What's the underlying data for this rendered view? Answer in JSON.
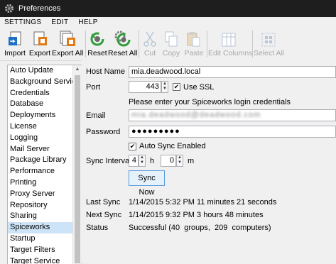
{
  "window": {
    "title": "Preferences"
  },
  "menu": [
    "SETTINGS",
    "EDIT",
    "HELP"
  ],
  "toolbar": {
    "import": "Import",
    "export": "Export",
    "export_all": "Export All",
    "reset": "Reset",
    "reset_all": "Reset All",
    "cut": "Cut",
    "copy": "Copy",
    "paste": "Paste",
    "edit_columns": "Edit Columns",
    "select_all": "Select All"
  },
  "nav": {
    "items": [
      "Auto Update",
      "Background Service",
      "Credentials",
      "Database",
      "Deployments",
      "License",
      "Logging",
      "Mail Server",
      "Package Library",
      "Performance",
      "Printing",
      "Proxy Server",
      "Repository",
      "Sharing",
      "Spiceworks",
      "Startup",
      "Target Filters",
      "Target Service"
    ],
    "selected": "Spiceworks"
  },
  "form": {
    "host_name_label": "Host Name",
    "host_name_value": "mia.deadwood.local",
    "port_label": "Port",
    "port_value": "443",
    "use_ssl_label": "Use SSL",
    "use_ssl_checked": true,
    "hint": "Please enter your Spiceworks login credentials",
    "email_label": "Email",
    "email_value": "mia.deadwood@deadwood.com",
    "password_label": "Password",
    "password_value": "●●●●●●●●●",
    "auto_sync_label": "Auto Sync Enabled",
    "auto_sync_checked": true,
    "sync_interval_label": "Sync Interval",
    "sync_hours": "4",
    "hours_unit": "h",
    "sync_minutes": "0",
    "minutes_unit": "m",
    "sync_now": "Sync Now",
    "last_sync_label": "Last Sync",
    "last_sync_value": "1/14/2015 5:32 PM  11 minutes 21 seconds",
    "next_sync_label": "Next Sync",
    "next_sync_value": "1/14/2015 9:32 PM 3 hours 48 minutes",
    "status_label": "Status",
    "status_value": "Successful (40  groups,  209  computers)"
  },
  "colors": {
    "accent_blue": "#1e6fc8",
    "reset_green": "#2e9d3a",
    "selection": "#cde3f7"
  }
}
